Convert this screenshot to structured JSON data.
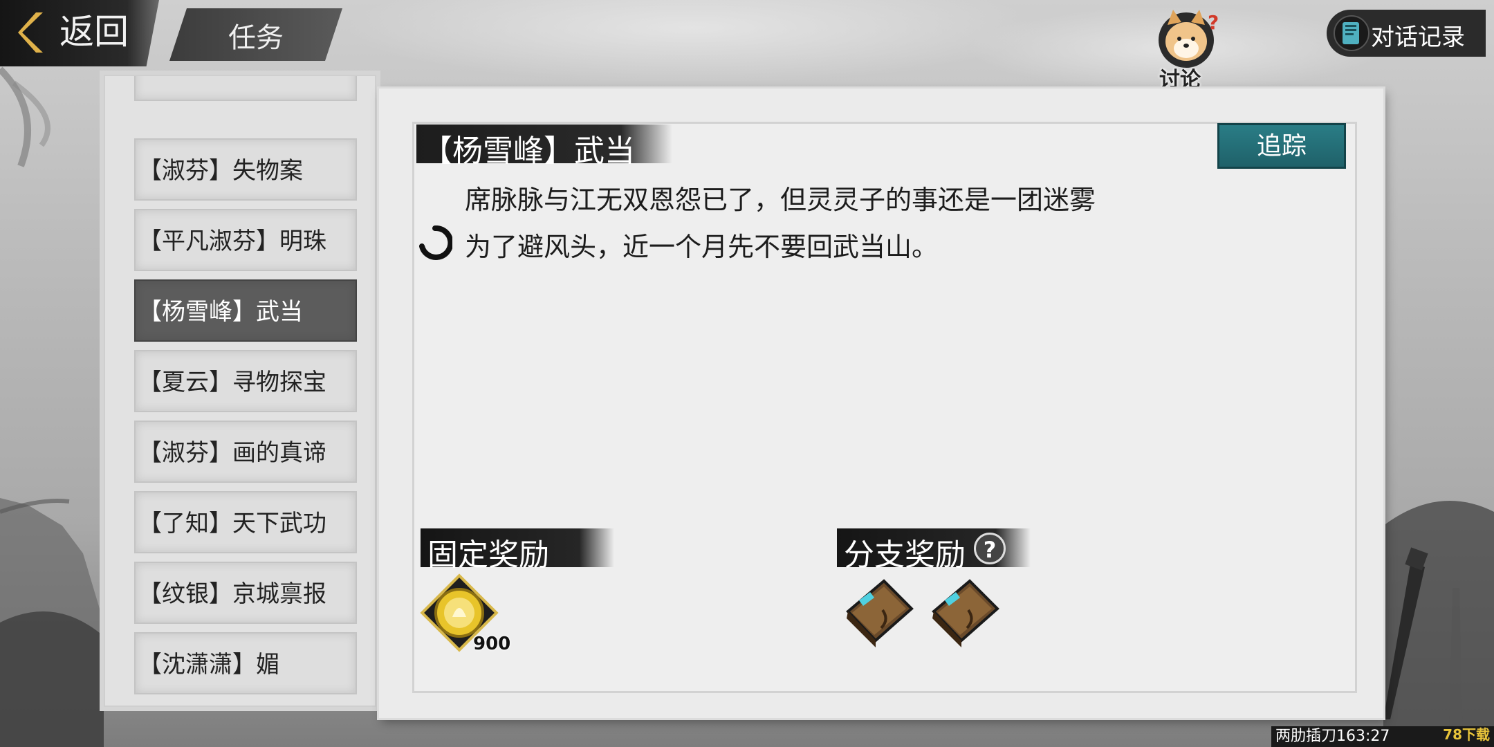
{
  "header": {
    "back_label": "返回",
    "title": "任务",
    "discuss_label": "讨论",
    "dialog_log_label": "对话记录"
  },
  "quest_list": {
    "items": [
      {
        "label": "【淑芬】失物案"
      },
      {
        "label": "【平凡淑芬】明珠"
      },
      {
        "label": "【杨雪峰】武当",
        "selected": true
      },
      {
        "label": "【夏云】寻物探宝"
      },
      {
        "label": "【淑芬】画的真谛"
      },
      {
        "label": "【了知】天下武功"
      },
      {
        "label": "【纹银】京城禀报"
      },
      {
        "label": "【沈潇潇】媚"
      }
    ]
  },
  "quest_detail": {
    "title": "【杨雪峰】武当",
    "track_label": "追踪",
    "description_lines": [
      "席脉脉与江无双恩怨已了，但灵灵子的事还是一团迷雾",
      "为了避风头，近一个月先不要回武当山。"
    ]
  },
  "rewards": {
    "fixed_label": "固定奖励",
    "fixed_item_count": "900",
    "branch_label": "分支奖励",
    "branch_help": "?"
  },
  "status_bar": {
    "text": "两肋插刀163:27",
    "watermark": "78下载"
  },
  "colors": {
    "track_button": "#237078",
    "selected_item": "#5c5c5c",
    "ink_dark": "#1d1d1d"
  }
}
